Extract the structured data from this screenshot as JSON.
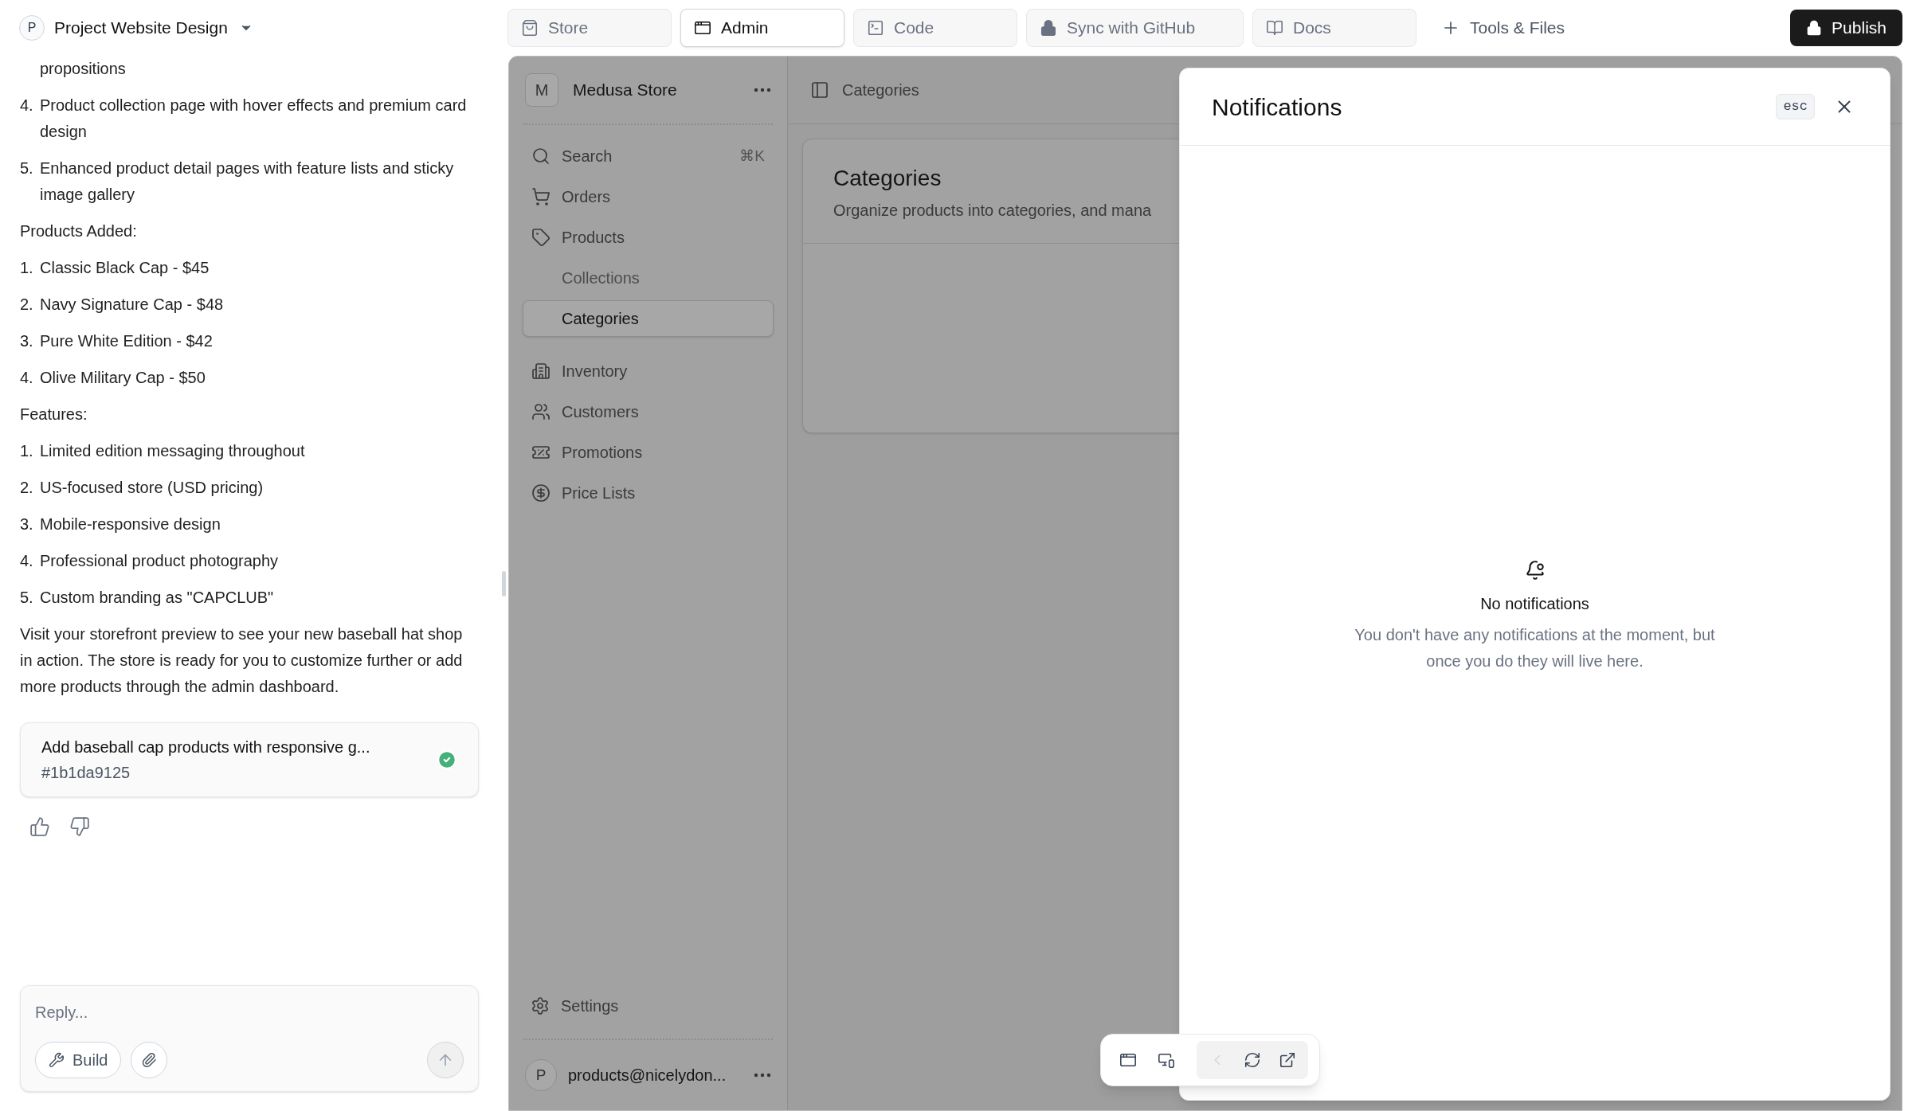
{
  "project": {
    "avatar": "P",
    "name": "Project Website Design"
  },
  "tabs": [
    {
      "label": "Store",
      "selected": false
    },
    {
      "label": "Admin",
      "selected": true
    },
    {
      "label": "Code",
      "selected": false
    },
    {
      "label": "Sync with GitHub",
      "selected": false
    },
    {
      "label": "Docs",
      "selected": false
    }
  ],
  "tools_button": "Tools & Files",
  "publish_button": "Publish",
  "chat": {
    "blocks": [
      {
        "kind": "continuation",
        "text": "propositions"
      },
      {
        "kind": "item",
        "number": "4.",
        "text": "Product collection page with hover effects and premium card design"
      },
      {
        "kind": "item",
        "number": "5.",
        "text": "Enhanced product detail pages with feature lists and sticky image gallery"
      },
      {
        "kind": "heading",
        "text": "Products Added:"
      },
      {
        "kind": "item",
        "number": "1.",
        "text": "Classic Black Cap - $45"
      },
      {
        "kind": "item",
        "number": "2.",
        "text": "Navy Signature Cap - $48"
      },
      {
        "kind": "item",
        "number": "3.",
        "text": "Pure White Edition - $42"
      },
      {
        "kind": "item",
        "number": "4.",
        "text": "Olive Military Cap - $50"
      },
      {
        "kind": "heading",
        "text": "Features:"
      },
      {
        "kind": "item",
        "number": "1.",
        "text": "Limited edition messaging throughout"
      },
      {
        "kind": "item",
        "number": "2.",
        "text": "US-focused store (USD pricing)"
      },
      {
        "kind": "item",
        "number": "3.",
        "text": "Mobile-responsive design"
      },
      {
        "kind": "item",
        "number": "4.",
        "text": "Professional product photography"
      },
      {
        "kind": "item",
        "number": "5.",
        "text": "Custom branding as \"CAPCLUB\""
      },
      {
        "kind": "paragraph",
        "text": "Visit your storefront preview to see your new baseball hat shop in action. The store is ready for you to customize further or add more products through the admin dashboard."
      }
    ],
    "commit": {
      "title": "Add baseball cap products with responsive g...",
      "hash": "#1b1da9125",
      "completed": true
    },
    "reply": {
      "placeholder": "Reply...",
      "build_button": "Build"
    }
  },
  "admin": {
    "store": {
      "avatar": "M",
      "name": "Medusa Store"
    },
    "nav": [
      {
        "label": "Search",
        "shortcut": "⌘K",
        "selected": false
      },
      {
        "label": "Orders",
        "selected": false
      },
      {
        "label": "Products",
        "selected": false,
        "children": [
          {
            "label": "Collections",
            "selected": false
          },
          {
            "label": "Categories",
            "selected": true
          }
        ]
      },
      {
        "label": "Inventory",
        "selected": false
      },
      {
        "label": "Customers",
        "selected": false
      },
      {
        "label": "Promotions",
        "selected": false
      },
      {
        "label": "Price Lists",
        "selected": false
      }
    ],
    "settings": "Settings",
    "account": {
      "avatar": "P",
      "email": "products@nicelydon..."
    },
    "breadcrumb": "Categories",
    "page": {
      "title": "Categories",
      "subtitle": "Organize products into categories, and mana"
    }
  },
  "notifications": {
    "title": "Notifications",
    "esc_key": "esc",
    "empty_title": "No notifications",
    "empty_text": "You don't have any notifications at the moment, but once you do they will live here."
  },
  "preview_toolbar": {
    "back_disabled": true
  }
}
